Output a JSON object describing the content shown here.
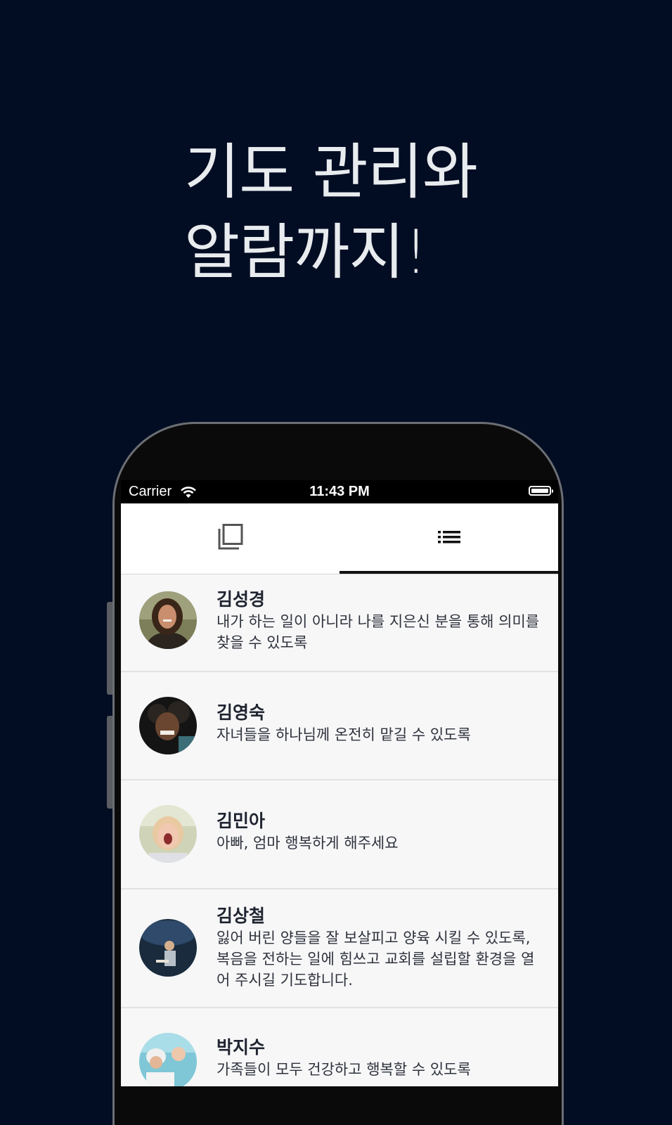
{
  "headline": {
    "line1": "기도 관리와",
    "line2": "알람까지!"
  },
  "status_bar": {
    "carrier": "Carrier",
    "time": "11:43 PM",
    "icons": [
      "wifi-icon",
      "battery-icon"
    ]
  },
  "tabs": [
    {
      "icon": "copy-icon",
      "active": false
    },
    {
      "icon": "list-icon",
      "active": true
    }
  ],
  "prayers": [
    {
      "name": "김성경",
      "message": "내가 하는 일이 아니라 나를 지은신 분을 통해 의미를 찾을 수 있도록",
      "avatar": "avatar-photo"
    },
    {
      "name": "김영숙",
      "message": "자녀들을 하나님께 온전히 맡길 수 있도록",
      "avatar": "avatar-photo"
    },
    {
      "name": "김민아",
      "message": "아빠, 엄마 행복하게 해주세요",
      "avatar": "avatar-photo"
    },
    {
      "name": "김상철",
      "message": "잃어 버린 양들을 잘 보살피고 양육 시킬 수 있도록, 복음을 전하는 일에 힘쓰고 교회를 설립할 환경을 열어 주시길 기도합니다.",
      "avatar": "avatar-photo"
    },
    {
      "name": "박지수",
      "message": "가족들이 모두 건강하고 행복할 수 있도록",
      "avatar": "avatar-photo"
    }
  ],
  "colors": {
    "background": "#020d23",
    "headline": "#e9ecef",
    "list_background": "#f7f7f8",
    "tab_indicator": "#111111"
  }
}
